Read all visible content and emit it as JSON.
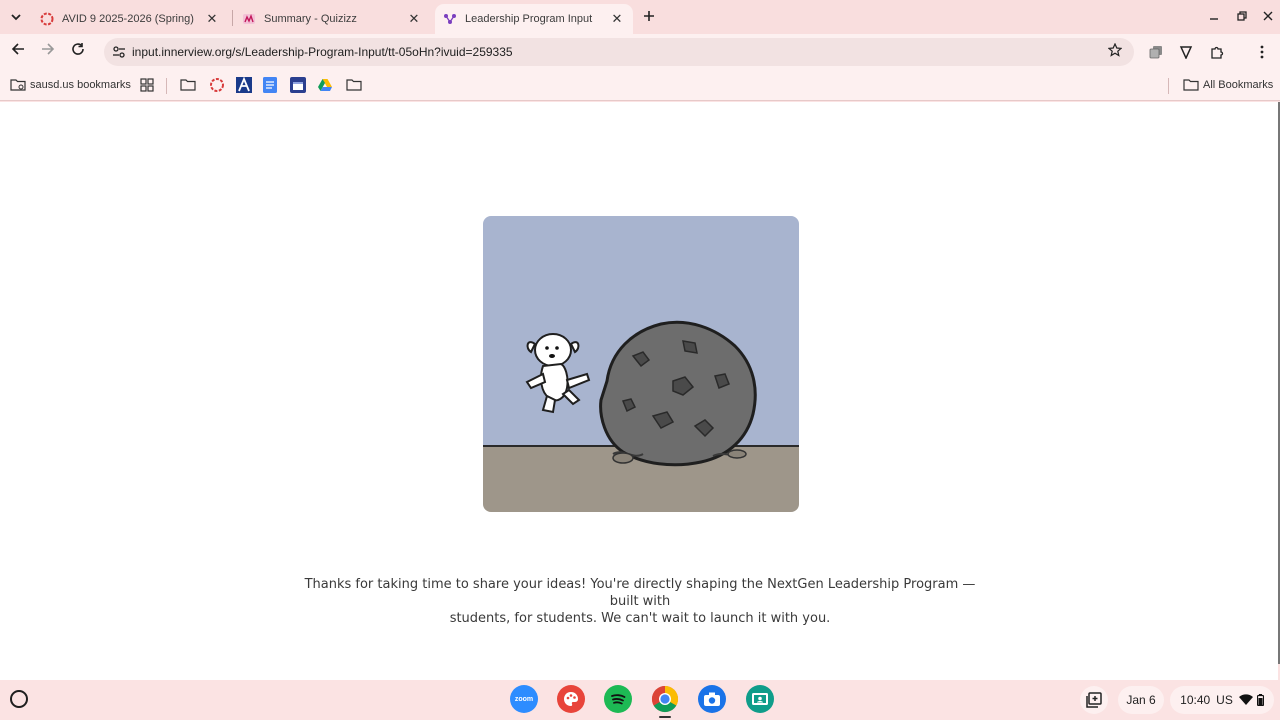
{
  "tabs": [
    {
      "title": "AVID 9 2025-2026 (Spring)",
      "close": "✕"
    },
    {
      "title": "Summary - Quizizz",
      "close": "✕"
    },
    {
      "title": "Leadership Program Input",
      "close": "✕",
      "active": true
    }
  ],
  "toolbar": {
    "url": "input.innerview.org/s/Leadership-Program-Input/tt-05oHn?ivuid=259335"
  },
  "bookmarks": {
    "folder_label": "sausd.us bookmarks",
    "all_label": "All Bookmarks"
  },
  "page": {
    "message_line1": "Thanks for taking  time to share your ideas! You're directly shaping the NextGen Leadership Program — built with",
    "message_line2": "students, for students. We can't wait to launch it with you."
  },
  "shelf": {
    "apps": [
      "zoom-app",
      "paint-app",
      "spotify-app",
      "chrome-app",
      "camera-app",
      "classroom-app"
    ],
    "zoom_label": "zoom",
    "date": "Jan 6",
    "time": "10:40",
    "locale": "US"
  },
  "colors": {
    "tab_strip": "#f9dede",
    "toolbar": "#fdf0f0",
    "sky": "#a8b4cf",
    "ground": "#9e968a",
    "rock": "#6d6d6d"
  }
}
